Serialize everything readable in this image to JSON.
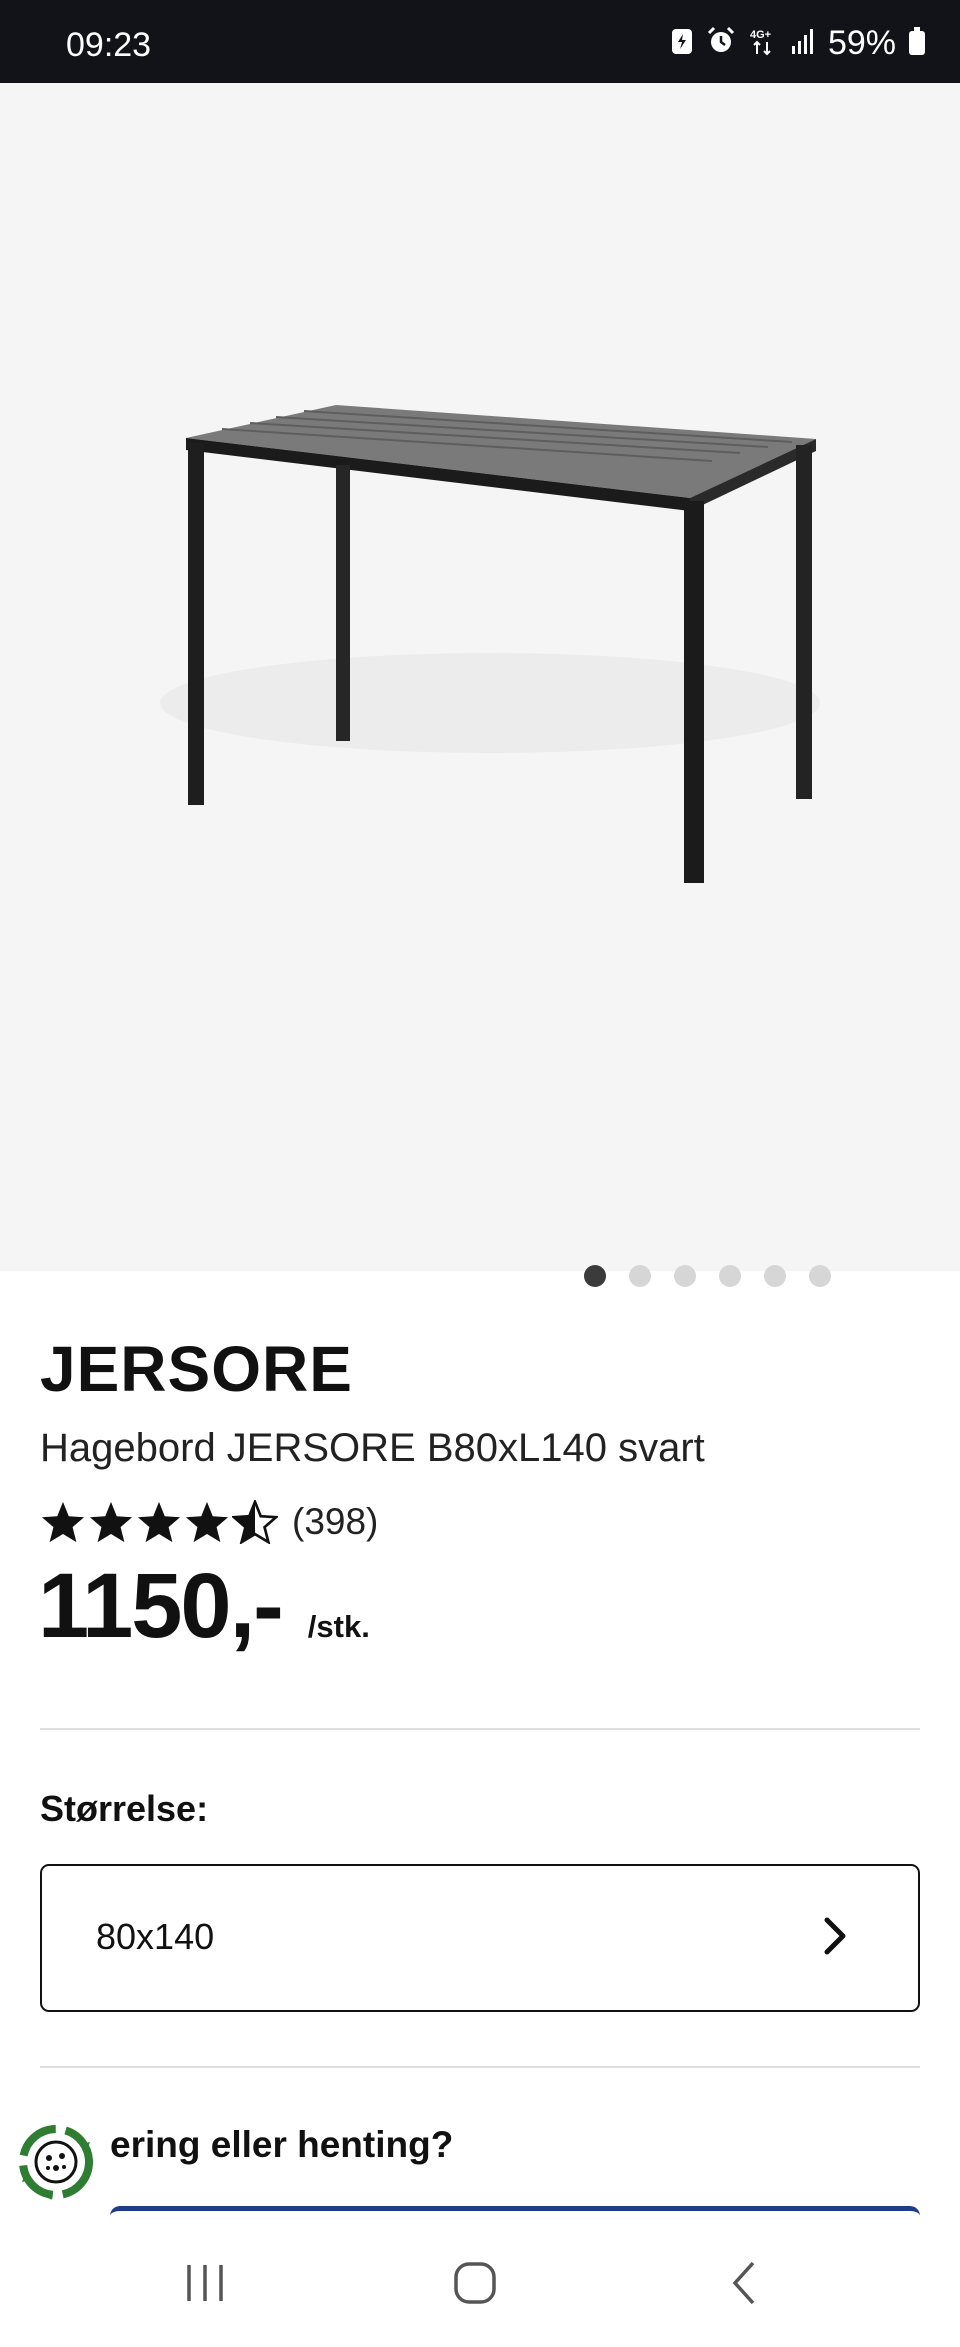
{
  "status_bar": {
    "time": "09:23",
    "battery": "59%",
    "network": "4G+",
    "icons": [
      "battery-saver-icon",
      "alarm-icon",
      "network-4g-icon",
      "signal-icon",
      "battery-icon"
    ]
  },
  "gallery": {
    "image_subject": "table-image",
    "dot_count": 6,
    "active_dot": 0
  },
  "product": {
    "name": "JERSORE",
    "description": "Hagebord JERSORE B80xL140 svart",
    "rating": 4.5,
    "review_count": "(398)",
    "price": "1150,-",
    "price_unit": "/stk."
  },
  "size": {
    "label": "Størrelse:",
    "value": "80x140"
  },
  "delivery": {
    "heading": "ering eller henting?"
  },
  "colors": {
    "accent_blue": "#1f3c88",
    "eco_green": "#2e7d32"
  },
  "nav": {
    "items": [
      "recent-apps-icon",
      "home-icon",
      "back-icon"
    ]
  }
}
